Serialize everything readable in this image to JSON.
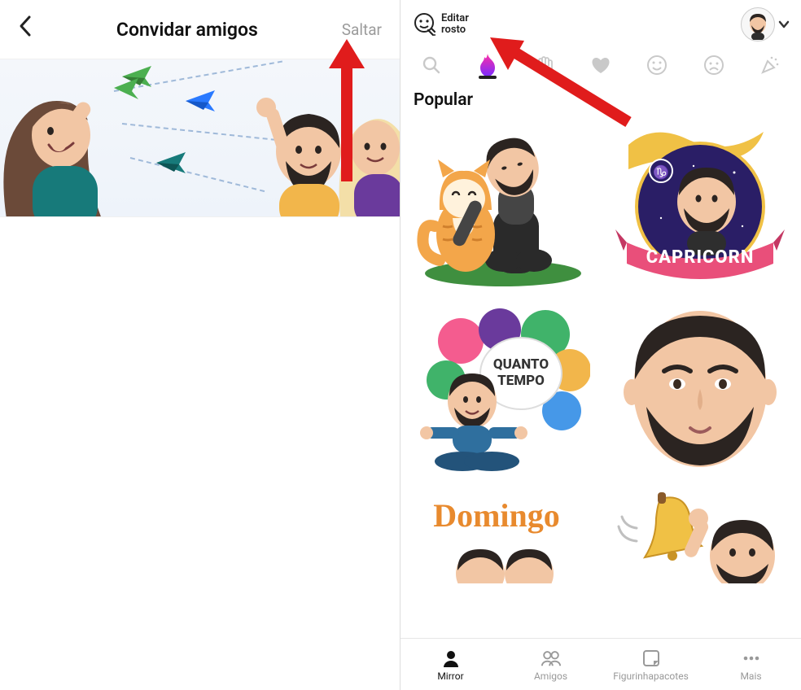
{
  "left": {
    "title": "Convidar amigos",
    "skip": "Saltar"
  },
  "right": {
    "edit_face": "Editar\nrosto",
    "section": "Popular",
    "stickers": {
      "capricorn": "CAPRICORN",
      "quanto_tempo_1": "QUANTO",
      "quanto_tempo_2": "TEMPO",
      "domingo": "Domingo"
    },
    "tabs": {
      "search": "search",
      "hot": "hot",
      "wave": "wave",
      "heart": "heart",
      "smile": "smile",
      "sad": "sad",
      "party": "party"
    },
    "nav": {
      "mirror": "Mirror",
      "amigos": "Amigos",
      "figurinhas": "Figurinhapacotes",
      "mais": "Mais"
    }
  },
  "colors": {
    "arrow": "#e01c1c",
    "flame1": "#ff2ea6",
    "flame2": "#7a2cff",
    "orange": "#e88a2e",
    "green_plane": "#4caf50",
    "blue_plane": "#2979ff",
    "skin": "#f2c6a4",
    "hair_dark": "#2b2421",
    "hair_brown": "#6b4a39",
    "hair_blonde": "#f3dfa8",
    "shirt_yellow": "#f2b64b",
    "shirt_teal": "#177a7a",
    "shirt_purple": "#6a3a9c",
    "cat": "#f3a64a",
    "grass": "#3f8f3f",
    "ribbon": "#e94f7a",
    "space": "#2a1e66",
    "gold": "#f0c145"
  }
}
